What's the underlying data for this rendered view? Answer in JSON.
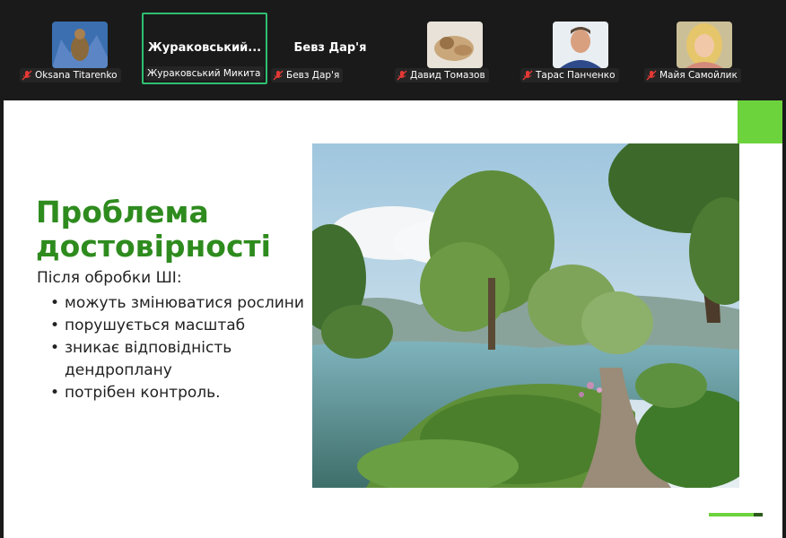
{
  "participants": [
    {
      "name": "Oksana Titarenko",
      "muted": true,
      "has_video": true
    },
    {
      "name": "Жураковський Микита",
      "display_name": "Жураковський...",
      "muted": false,
      "has_video": false,
      "active": true
    },
    {
      "name": "Бевз Дар'я",
      "display_name": "Бевз Дар'я",
      "muted": true,
      "has_video": false
    },
    {
      "name": "Давид Томазов",
      "muted": true,
      "has_video": true
    },
    {
      "name": "Тарас Панченко",
      "muted": true,
      "has_video": true
    },
    {
      "name": "Майя Самойлик",
      "muted": true,
      "has_video": true
    }
  ],
  "slide": {
    "title_line1": "Проблема",
    "title_line2": "достовірності",
    "subtitle": "Після обробки ШІ:",
    "bullets": [
      "можуть змінюватися рослини",
      "порушується масштаб",
      "зникає відповідність дендроплану",
      " потрібен контроль."
    ]
  },
  "colors": {
    "title_green": "#2e8b1e",
    "accent_green": "#6dd33c",
    "active_speaker_border": "#2fbf71",
    "muted_red": "#e53935"
  }
}
